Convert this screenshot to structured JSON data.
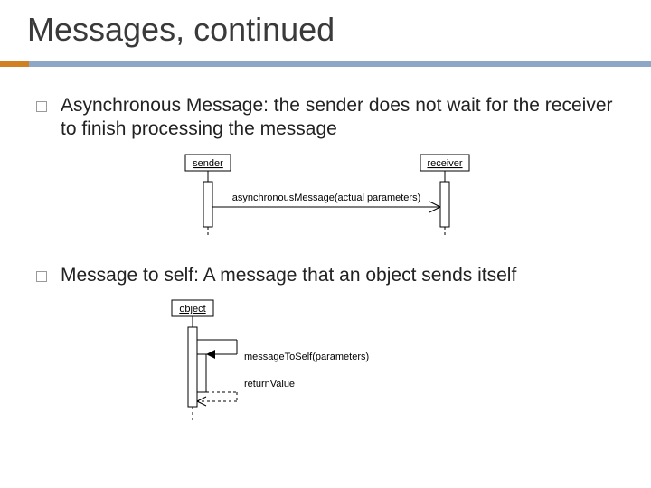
{
  "title": "Messages, continued",
  "bullets": [
    {
      "text": "Asynchronous Message: the sender does not wait for the receiver to finish processing the message"
    },
    {
      "text": "Message to self: A message that an object sends itself"
    }
  ],
  "diagram1": {
    "lifeline_left": "sender",
    "lifeline_right": "receiver",
    "message_label": "asynchronousMessage(actual parameters)"
  },
  "diagram2": {
    "lifeline": "object",
    "message_label": "messageToSelf(parameters)",
    "return_label": "returnValue"
  }
}
